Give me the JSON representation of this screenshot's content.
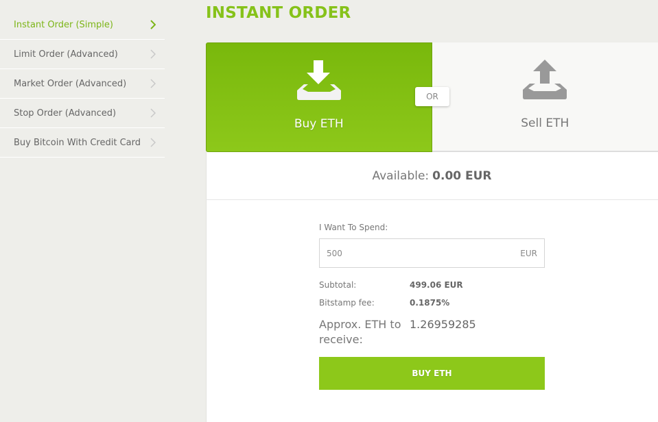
{
  "sidebar": {
    "items": [
      {
        "label": "Instant Order (Simple)",
        "active": true
      },
      {
        "label": "Limit Order (Advanced)",
        "active": false
      },
      {
        "label": "Market Order (Advanced)",
        "active": false
      },
      {
        "label": "Stop Order (Advanced)",
        "active": false
      },
      {
        "label": "Buy Bitcoin With Credit Card",
        "active": false
      }
    ]
  },
  "page": {
    "title": "INSTANT ORDER"
  },
  "switcher": {
    "buy_label": "Buy ETH",
    "sell_label": "Sell ETH",
    "or_label": "OR",
    "selected": "buy",
    "colors": {
      "accent": "#8dc81a",
      "inactive_icon": "#999999"
    }
  },
  "balance": {
    "label": "Available:",
    "value": "0.00 EUR"
  },
  "form": {
    "spend_label": "I Want To Spend:",
    "amount_value": "500",
    "currency": "EUR",
    "subtotal_label": "Subtotal:",
    "subtotal_value": "499.06 EUR",
    "fee_label": "Bitstamp fee:",
    "fee_value": "0.1875%",
    "receive_label": "Approx. ETH to receive:",
    "receive_value": "1.26959285",
    "submit_label": "BUY ETH"
  }
}
